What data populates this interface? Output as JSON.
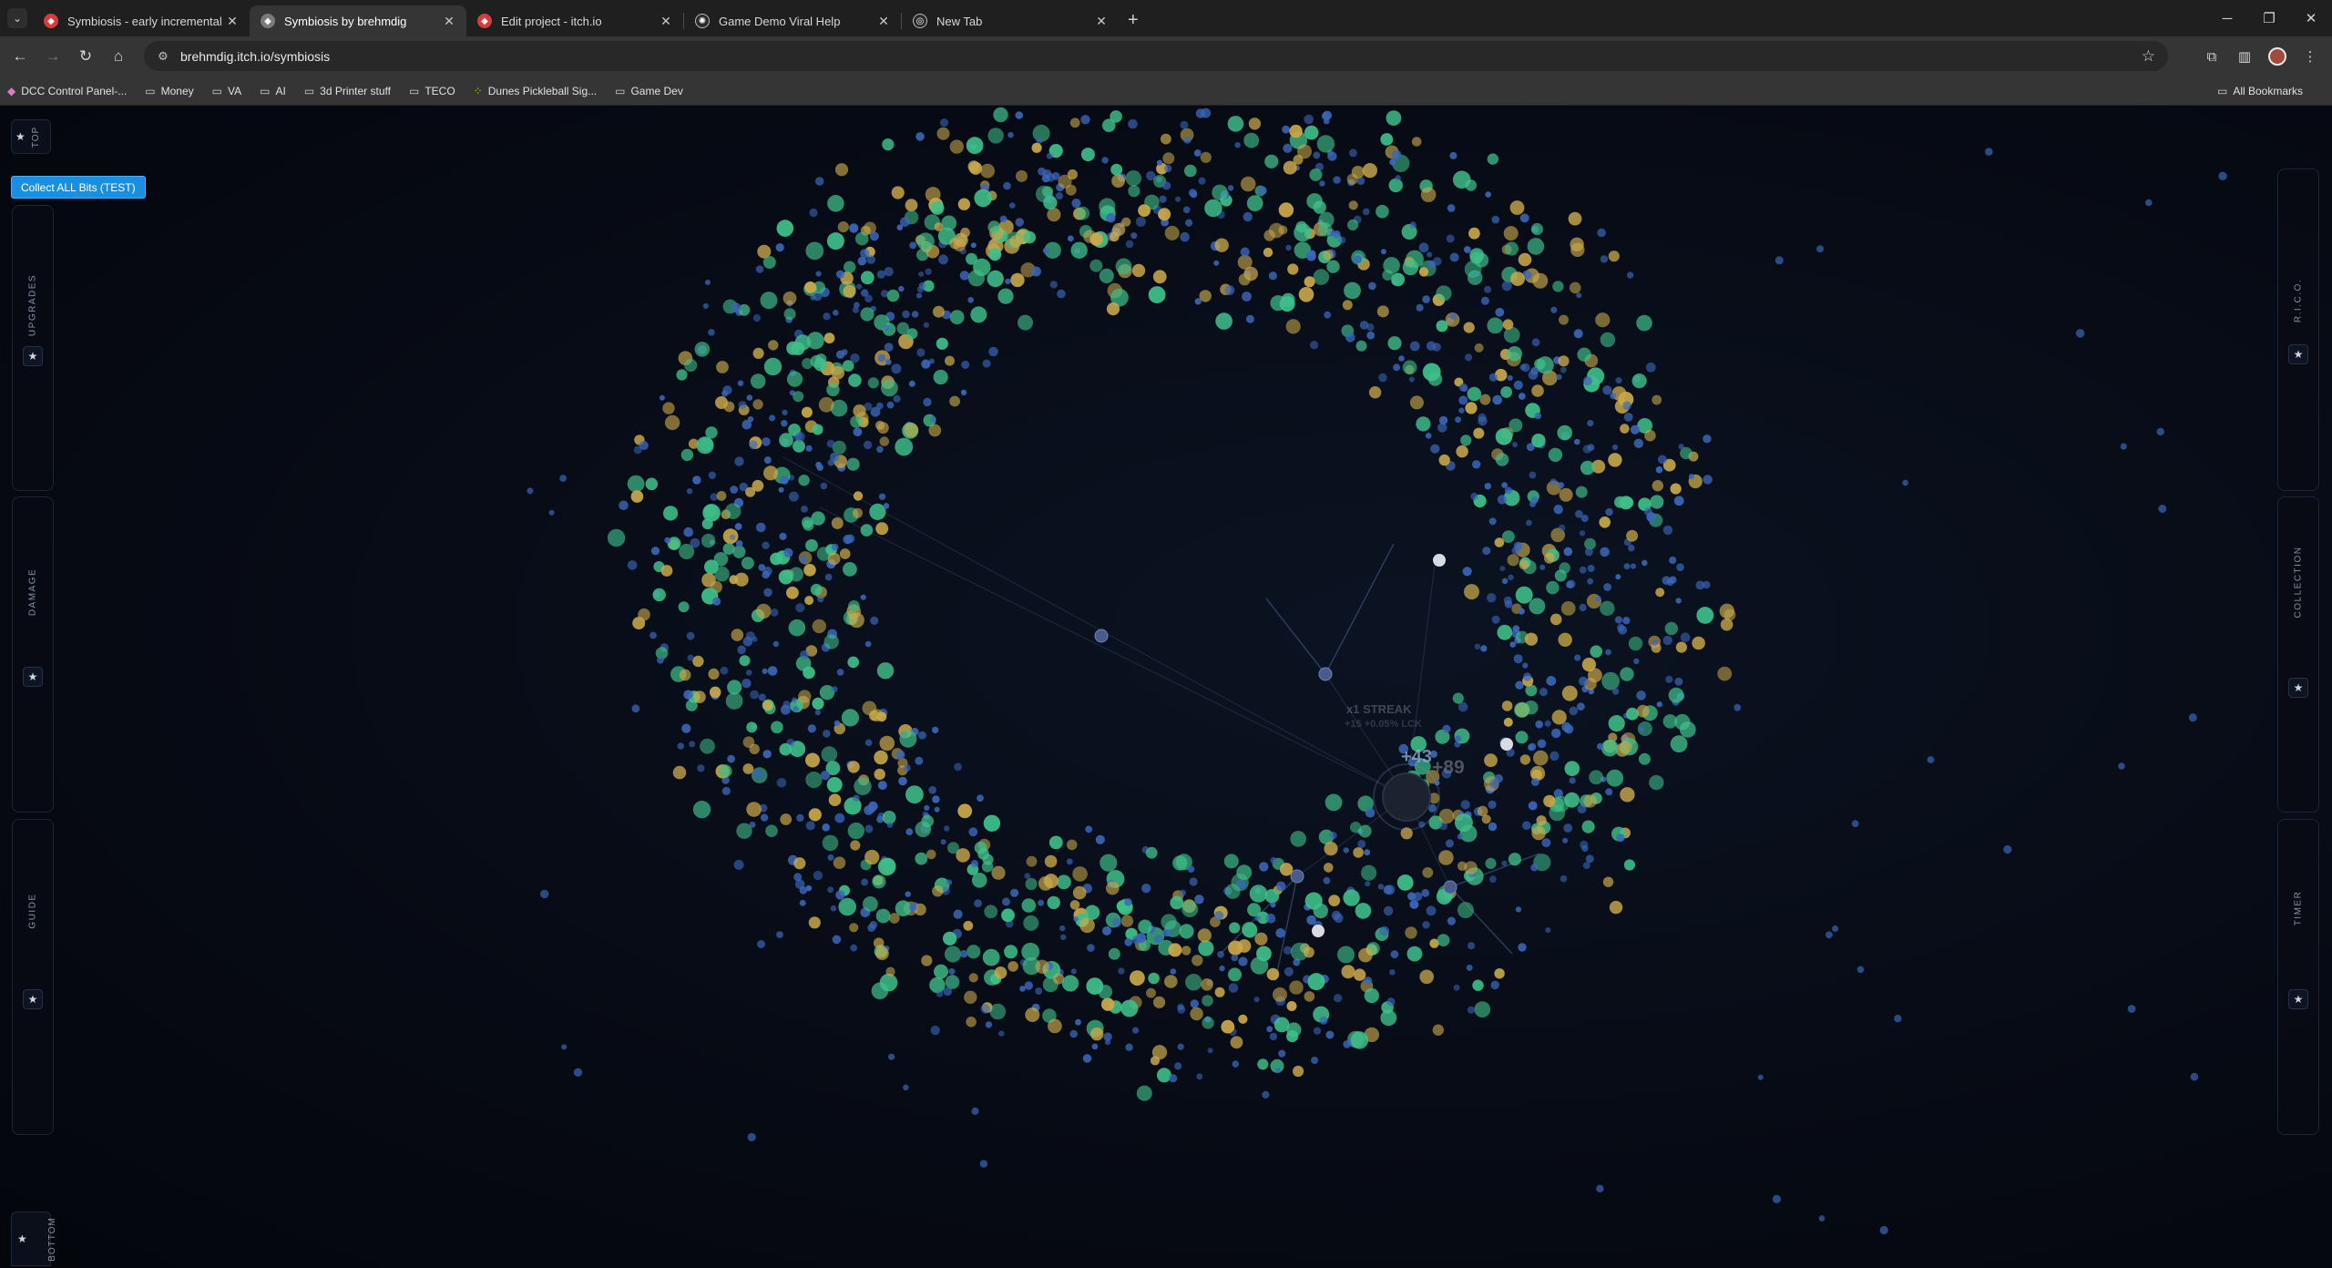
{
  "browser": {
    "tabs": [
      {
        "title": "Symbiosis - early incremental c",
        "favicon": "itch-red",
        "active": false
      },
      {
        "title": "Symbiosis by brehmdig",
        "favicon": "itch-gray",
        "active": true
      },
      {
        "title": "Edit project - itch.io",
        "favicon": "itch-red",
        "active": false
      },
      {
        "title": "Game Demo Viral Help",
        "favicon": "chatgpt",
        "active": false
      },
      {
        "title": "New Tab",
        "favicon": "chrome",
        "active": false
      }
    ],
    "url": "brehmdig.itch.io/symbiosis",
    "bookmarks": [
      {
        "label": "DCC Control Panel-...",
        "icon": "pink-diamond"
      },
      {
        "label": "Money",
        "icon": "folder"
      },
      {
        "label": "VA",
        "icon": "folder"
      },
      {
        "label": "AI",
        "icon": "folder"
      },
      {
        "label": "3d Printer stuff",
        "icon": "folder"
      },
      {
        "label": "TECO",
        "icon": "folder"
      },
      {
        "label": "Dunes Pickleball Sig...",
        "icon": "gold-dots"
      },
      {
        "label": "Game Dev",
        "icon": "folder"
      }
    ],
    "all_bookmarks_label": "All Bookmarks"
  },
  "game": {
    "top_label": "TOP",
    "bottom_label": "BOTTOM",
    "collect_button": "Collect ALL Bits (TEST)",
    "left_panels": [
      "UPGRADES",
      "DAMAGE",
      "GUIDE"
    ],
    "right_panels": [
      "R.I.C.O.",
      "COLLECTION",
      "TIMER"
    ],
    "floating": {
      "streak": "x1 STREAK",
      "bonus": "+15 +0.05% LCK",
      "gain1": "+43",
      "gain2": "+89"
    },
    "colors": {
      "green_bit": "#3fbf8a",
      "gold_bit": "#c9a84a",
      "blue_bit": "#3b66b8",
      "collect_button": "#1a8fe0"
    }
  }
}
